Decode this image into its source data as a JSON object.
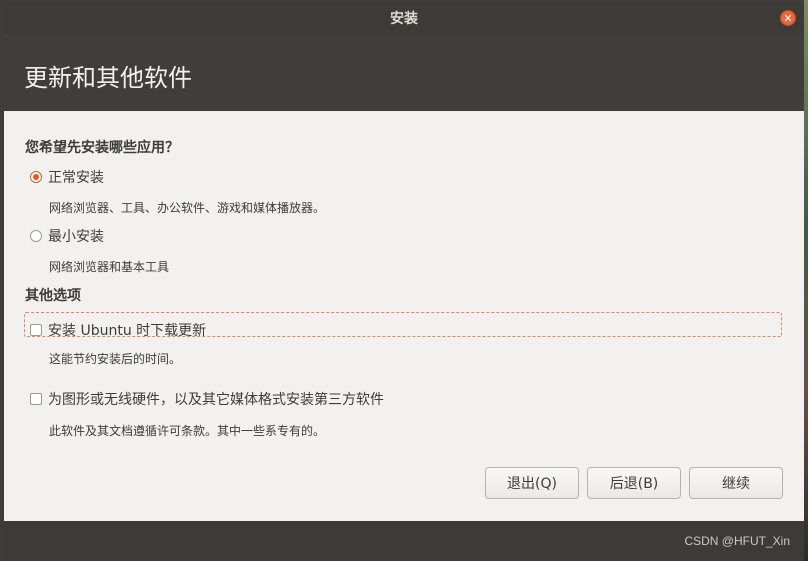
{
  "window": {
    "title": "安装",
    "close_icon": "close-icon"
  },
  "header": {
    "page_title": "更新和其他软件"
  },
  "install_type": {
    "question": "您希望先安装哪些应用？",
    "options": [
      {
        "label": "正常安装",
        "description": "网络浏览器、工具、办公软件、游戏和媒体播放器。",
        "selected": true
      },
      {
        "label": "最小安装",
        "description": "网络浏览器和基本工具",
        "selected": false
      }
    ]
  },
  "other_options": {
    "title": "其他选项",
    "items": [
      {
        "label": "安装 Ubuntu 时下载更新",
        "description": "这能节约安装后的时间。",
        "checked": false
      },
      {
        "label": "为图形或无线硬件，以及其它媒体格式安装第三方软件",
        "description": "此软件及其文档遵循许可条款。其中一些系专有的。",
        "checked": false
      }
    ]
  },
  "buttons": {
    "quit": "退出(Q)",
    "back": "后退(B)",
    "continue": "继续"
  },
  "footer": {
    "watermark": "CSDN @HFUT_Xin"
  },
  "colors": {
    "accent": "#e95420",
    "titlebar": "#3c3b37",
    "content_bg": "#f2f1f0"
  }
}
